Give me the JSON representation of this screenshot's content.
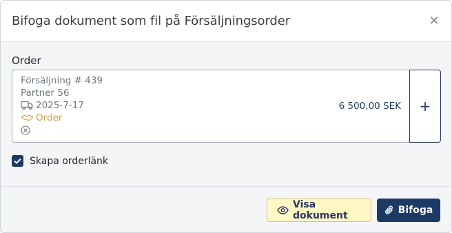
{
  "dialog": {
    "title": "Bifoga dokument som fil på Försäljningsorder",
    "close_symbol": "×"
  },
  "order_field": {
    "label": "Order",
    "card": {
      "sale_number": "Försäljning # 439",
      "partner": "Partner 56",
      "delivery_date": "2025-7-17",
      "status": "Order",
      "amount": "6 500,00 SEK"
    },
    "add_symbol": "+"
  },
  "create_link": {
    "label": "Skapa orderlänk",
    "checked": true
  },
  "footer": {
    "view_label": "Visa dokument",
    "attach_label": "Bifoga"
  },
  "icons": {
    "delivery": "truck-icon",
    "status": "handshake-icon",
    "remove": "circle-x-icon",
    "view": "eye-icon",
    "attach": "paperclip-icon",
    "check": "checkmark-icon"
  },
  "colors": {
    "primary": "#1c3a63",
    "status": "#d3a04a",
    "view_button_bg": "#fff8c5"
  }
}
